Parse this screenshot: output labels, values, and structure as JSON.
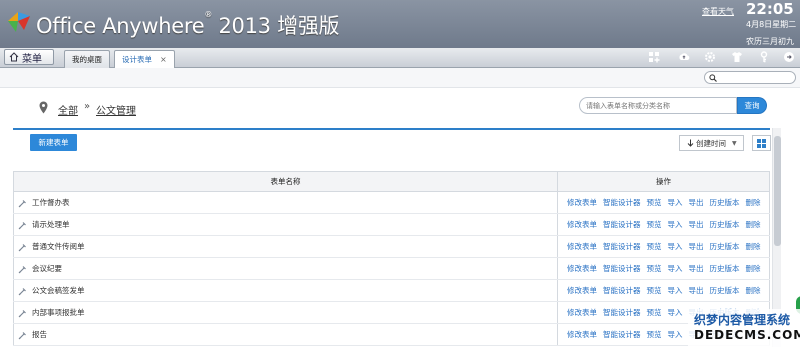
{
  "header": {
    "app_name": "Office Anywhere",
    "registered": "®",
    "version": "2013 增强版",
    "weather_link": "查看天气",
    "time": "22:05",
    "date": "4月8日星期二",
    "lunar_date": "农历三月初九"
  },
  "nav": {
    "menu_label": "菜单",
    "tabs": [
      {
        "label": "我的桌面"
      },
      {
        "label": "设计表单",
        "close": "×"
      }
    ]
  },
  "breadcrumb": {
    "root": "全部",
    "separator": "»",
    "current": "公文管理"
  },
  "search": {
    "placeholder": "请输入表单名称或分类名称",
    "button": "查询"
  },
  "actions": {
    "new_form": "新建表单",
    "sort_label": "创建时间",
    "sort_caret": "▼"
  },
  "table": {
    "headers": [
      "表单名称",
      "操作"
    ],
    "operations": [
      "修改表单",
      "智能设计器",
      "预览",
      "导入",
      "导出",
      "历史版本",
      "删除"
    ],
    "rows": [
      {
        "name": "工作督办表"
      },
      {
        "name": "请示处理单"
      },
      {
        "name": "普通文件传阅单"
      },
      {
        "name": "会议纪要"
      },
      {
        "name": "公文会稿签发单"
      },
      {
        "name": "内部事项报批单"
      },
      {
        "name": "报告"
      }
    ]
  },
  "watermark": {
    "line1": "织梦内容管理系统",
    "line2": "DEDECMS.COM"
  },
  "colors": {
    "header_bg": "#7b8595",
    "accent_blue": "#2d88d9",
    "link_blue": "#2a72c4"
  }
}
